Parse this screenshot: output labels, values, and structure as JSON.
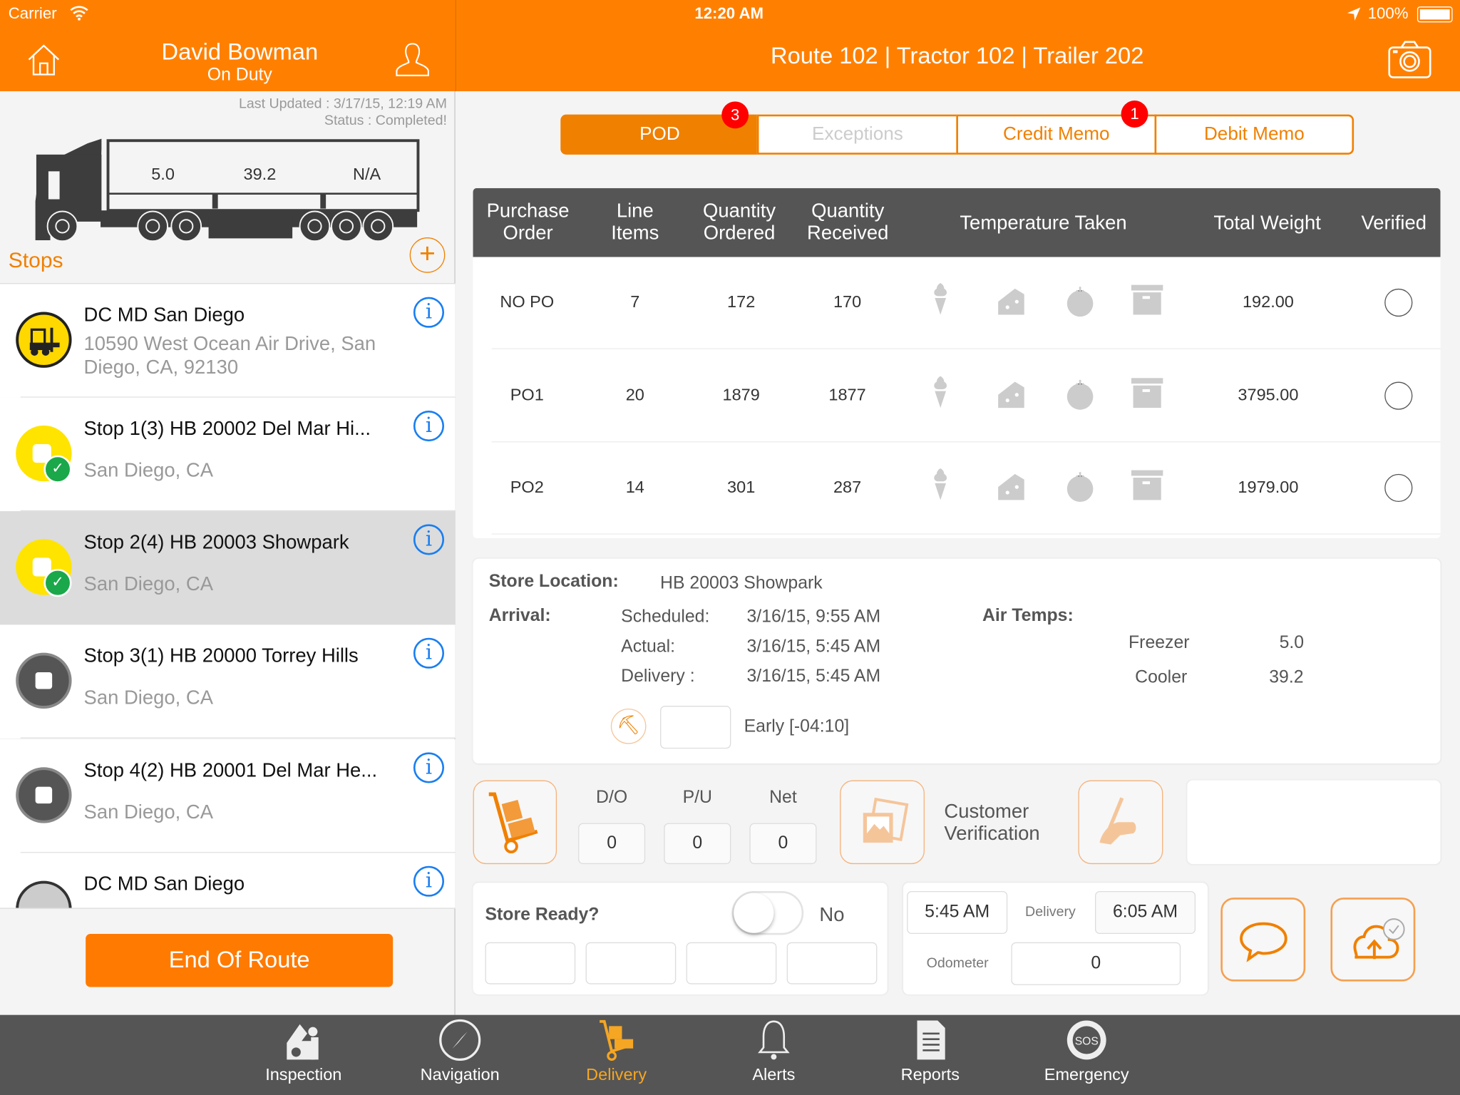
{
  "status_bar": {
    "carrier": "Carrier",
    "time": "12:20 AM",
    "battery": "100%"
  },
  "left_header": {
    "driver_name": "David Bowman",
    "duty_status": "On Duty"
  },
  "right_header": {
    "title": "Route 102 | Tractor 102 | Trailer 202"
  },
  "summary": {
    "last_updated": "Last Updated : 3/17/15, 12:19 AM",
    "status": "Status : Completed!",
    "trailer_temps": [
      "5.0",
      "39.2",
      "N/A"
    ]
  },
  "stops": {
    "label": "Stops",
    "items": [
      {
        "title": "DC MD San Diego",
        "address": "10590 West Ocean Air Drive, San Diego, CA, 92130",
        "state": "depot"
      },
      {
        "title": "Stop 1(3) HB 20002 Del Mar Hi...",
        "address": "San Diego, CA",
        "state": "completed"
      },
      {
        "title": "Stop 2(4) HB 20003 Showpark",
        "address": "San Diego, CA",
        "state": "completed",
        "selected": true
      },
      {
        "title": "Stop 3(1) HB 20000 Torrey Hills",
        "address": "San Diego, CA",
        "state": "pending"
      },
      {
        "title": "Stop 4(2) HB 20001 Del Mar He...",
        "address": "San Diego, CA",
        "state": "pending"
      },
      {
        "title": "DC MD San Diego",
        "address": "",
        "state": "depot"
      }
    ]
  },
  "end_route_label": "End Of Route",
  "segments": [
    {
      "label": "POD",
      "badge": "3",
      "active": true
    },
    {
      "label": "Exceptions",
      "disabled": true
    },
    {
      "label": "Credit Memo",
      "badge": "1"
    },
    {
      "label": "Debit Memo"
    }
  ],
  "table": {
    "headers": {
      "po": "Purchase Order",
      "line": "Line Items",
      "ordered": "Quantity Ordered",
      "received": "Quantity Received",
      "temp": "Temperature Taken",
      "weight": "Total Weight",
      "verified": "Verified"
    },
    "rows": [
      {
        "po": "NO PO",
        "line": "7",
        "ordered": "172",
        "received": "170",
        "weight": "192.00",
        "verified": false
      },
      {
        "po": "PO1",
        "line": "20",
        "ordered": "1879",
        "received": "1877",
        "weight": "3795.00",
        "verified": false
      },
      {
        "po": "PO2",
        "line": "14",
        "ordered": "301",
        "received": "287",
        "weight": "1979.00",
        "verified": false
      }
    ],
    "temp_icons": [
      "ice-cream-icon",
      "cheese-icon",
      "tomato-icon",
      "box-icon"
    ]
  },
  "store": {
    "location_label": "Store Location:",
    "location": "HB 20003 Showpark",
    "arrival_label": "Arrival:",
    "scheduled_label": "Scheduled:",
    "scheduled": "3/16/15, 9:55 AM",
    "actual_label": "Actual:",
    "actual": "3/16/15, 5:45 AM",
    "delivery_label": "Delivery :",
    "delivery": "3/16/15, 5:45 AM",
    "air_temps_label": "Air Temps:",
    "freezer_label": "Freezer",
    "freezer": "5.0",
    "cooler_label": "Cooler",
    "cooler": "39.2",
    "early": "Early [-04:10]"
  },
  "counts": {
    "do_label": "D/O",
    "pu_label": "P/U",
    "net_label": "Net",
    "do": "0",
    "pu": "0",
    "net": "0"
  },
  "customer_verification": "Customer Verification",
  "store_ready": {
    "label": "Store Ready?",
    "value": "No",
    "on": false
  },
  "times": {
    "arrival": "5:45 AM",
    "delivery_label": "Delivery",
    "delivery": "6:05 AM",
    "odometer_label": "Odometer",
    "odometer": "0"
  },
  "tabs": [
    {
      "label": "Inspection"
    },
    {
      "label": "Navigation"
    },
    {
      "label": "Delivery",
      "active": true
    },
    {
      "label": "Alerts"
    },
    {
      "label": "Reports"
    },
    {
      "label": "Emergency"
    }
  ],
  "colors": {
    "brand": "#FF8000",
    "tabbar": "#555555",
    "badge": "#FF0000",
    "info": "#1A7EF0",
    "active_tab": "#F5A623"
  }
}
